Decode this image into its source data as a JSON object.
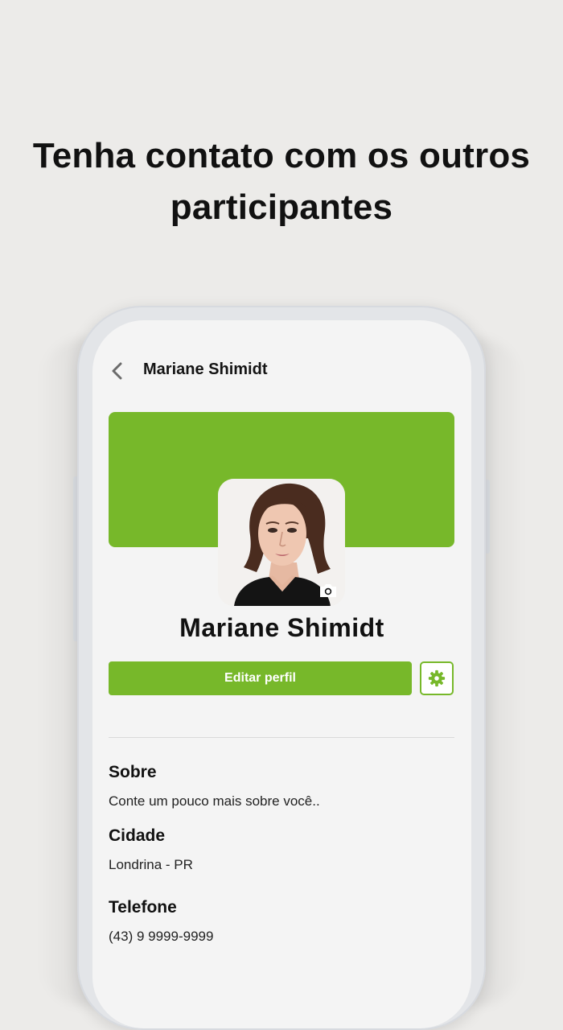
{
  "headline": {
    "line1": "Tenha contato com os outros",
    "line2": "participantes"
  },
  "topbar": {
    "title": "Mariane Shimidt",
    "back_icon": "chevron-left-icon"
  },
  "profile": {
    "name": "Mariane Shimidt",
    "cover_color": "#77b82a",
    "camera_icon": "camera-icon"
  },
  "actions": {
    "edit_label": "Editar perfil",
    "settings_icon": "gear-icon",
    "accent_color": "#77b82a"
  },
  "details": {
    "about_label": "Sobre",
    "about_value": "Conte um pouco mais sobre você..",
    "city_label": "Cidade",
    "city_value": "Londrina - PR",
    "phone_label": "Telefone",
    "phone_value": "(43) 9 9999-9999"
  }
}
